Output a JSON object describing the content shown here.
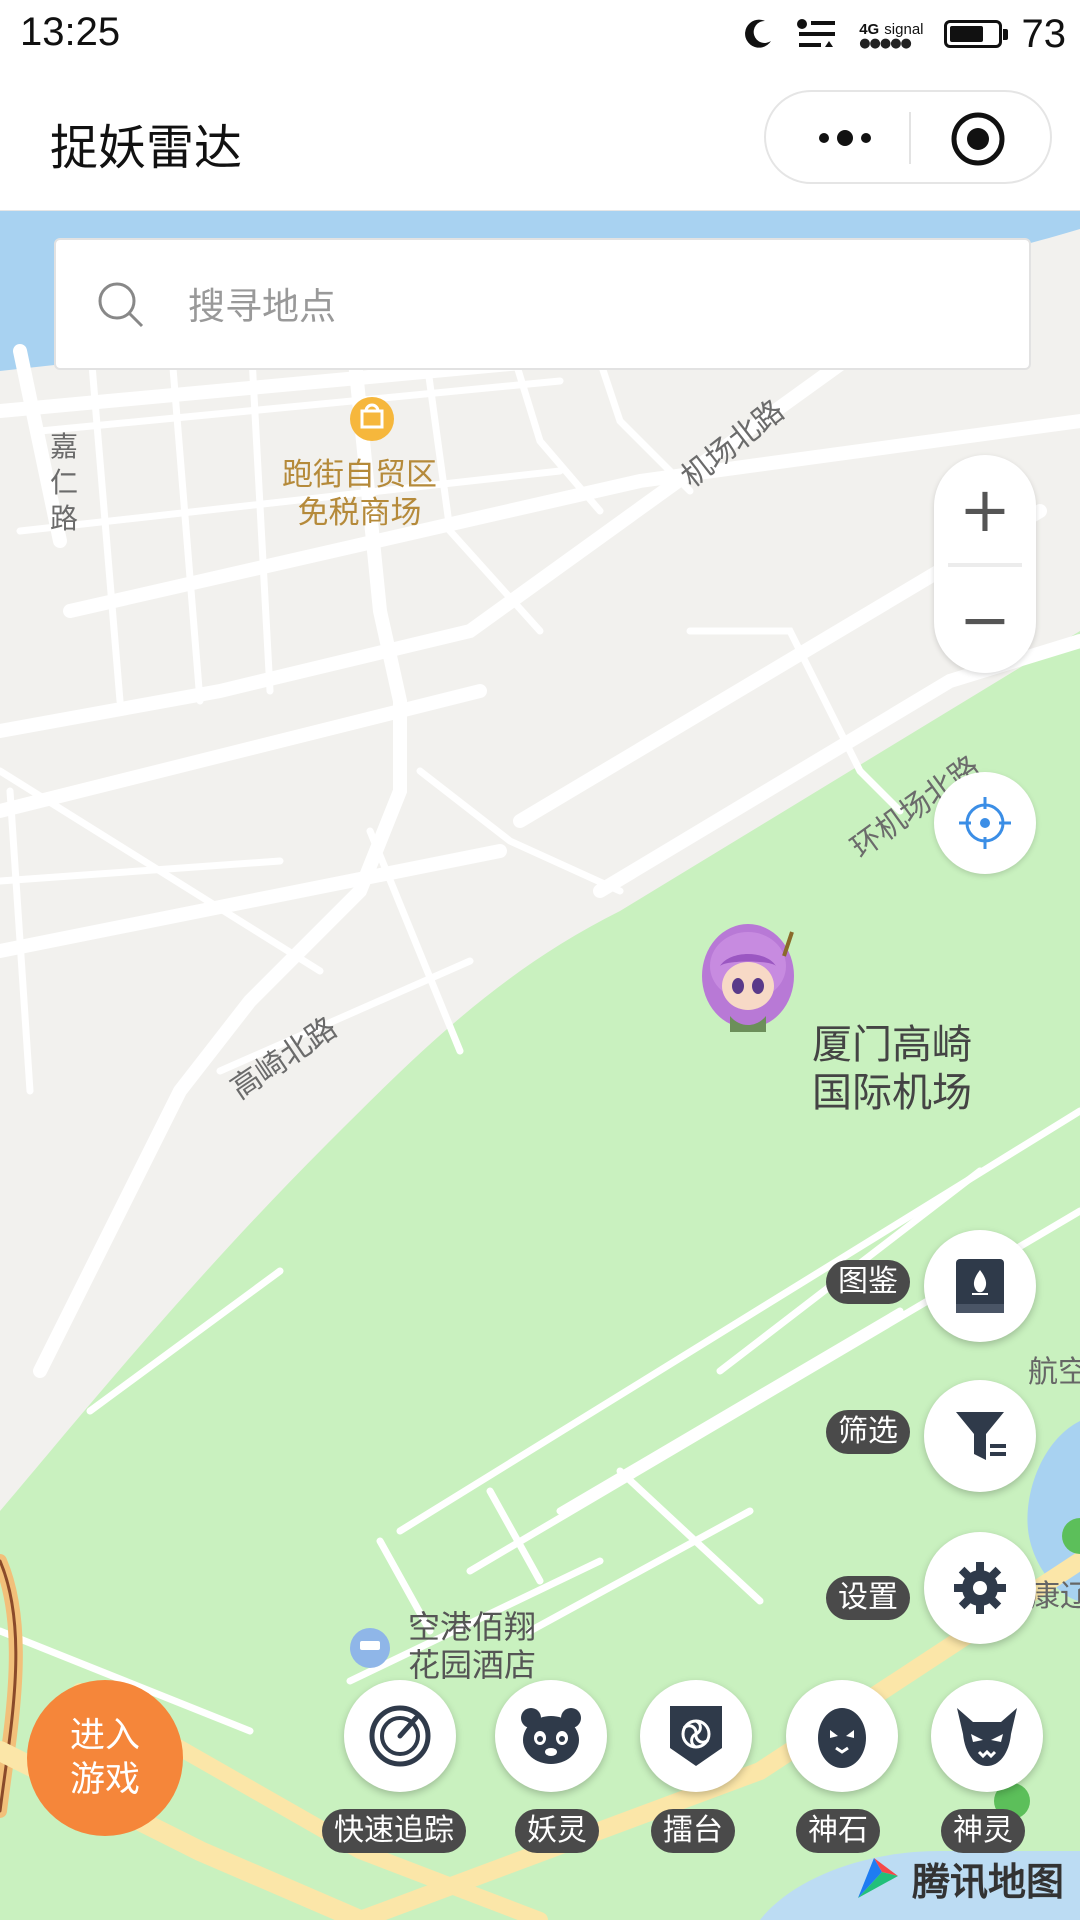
{
  "status_bar": {
    "time": "13:25",
    "network": "4G",
    "signal_label": "signal",
    "signal_dots": "●●●●●",
    "battery": "73",
    "battery_fraction": 0.73
  },
  "header": {
    "title": "捉妖雷达"
  },
  "search": {
    "placeholder": "搜寻地点"
  },
  "map": {
    "places": {
      "duty_free": "跑街自贸区\n免税商场",
      "airport": "厦门高崎\n国际机场",
      "hotel": "空港佰翔\n花园酒店",
      "aviation": "航空",
      "partial_right": "康辽"
    },
    "roads": {
      "jiaren": "嘉仁路",
      "jichang_north": "机场北路",
      "huan_jichang_north": "环机场北路",
      "gaoqi_north": "高崎北路"
    },
    "colors": {
      "land": "#f2f1ee",
      "green": "#c9f1bf",
      "road": "#ffffff",
      "water": "#a8d2f1",
      "highway": "#fbe6a8"
    },
    "attribution": "腾讯地图"
  },
  "zoom": {
    "in_label": "+",
    "out_label": "−"
  },
  "side_menu": [
    {
      "label": "图鉴",
      "icon": "book-icon"
    },
    {
      "label": "筛选",
      "icon": "filter-icon"
    },
    {
      "label": "设置",
      "icon": "gear-icon"
    }
  ],
  "enter_game": {
    "label": "进入\n游戏"
  },
  "bottom_menu": [
    {
      "label": "快速追踪",
      "icon": "radar-icon"
    },
    {
      "label": "妖灵",
      "icon": "panda-icon"
    },
    {
      "label": "擂台",
      "icon": "arena-icon"
    },
    {
      "label": "神石",
      "icon": "stone-icon"
    },
    {
      "label": "神灵",
      "icon": "demon-icon"
    }
  ],
  "accent_colors": {
    "enter_game": "#f5863a",
    "label_bg": "#4a4a4a",
    "icon_dark": "#2f3a4a",
    "locate_blue": "#3b8ee6"
  }
}
